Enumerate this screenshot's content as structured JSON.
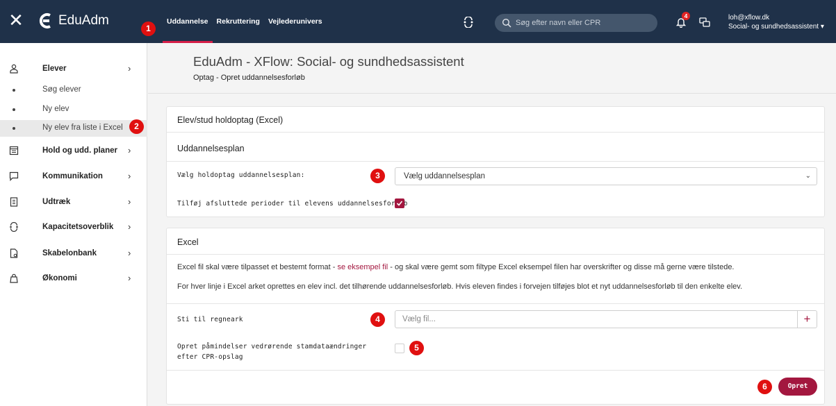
{
  "topbar": {
    "app_name": "EduAdm",
    "nav": [
      "Uddannelse",
      "Rekruttering",
      "Vejlederunivers"
    ],
    "search_placeholder": "Søg efter navn eller CPR",
    "notification_count": "4",
    "user_email": "loh@xflow.dk",
    "user_role": "Social- og sundhedsassistent",
    "user_chevron": "▾"
  },
  "sidebar": {
    "items": [
      {
        "label": "Elever",
        "icon": "person-icon"
      },
      {
        "label": "Hold og udd. planer",
        "icon": "calendar-icon"
      },
      {
        "label": "Kommunikation",
        "icon": "chat-icon"
      },
      {
        "label": "Udtræk",
        "icon": "document-icon"
      },
      {
        "label": "Kapacitetsoverblik",
        "icon": "capacity-icon"
      },
      {
        "label": "Skabelonbank",
        "icon": "template-icon"
      },
      {
        "label": "Økonomi",
        "icon": "bag-icon"
      }
    ],
    "subitems": [
      "Søg elever",
      "Ny elev",
      "Ny elev fra liste i Excel"
    ],
    "chevron": "›"
  },
  "callouts": [
    "1",
    "2",
    "3",
    "4",
    "5",
    "6"
  ],
  "page": {
    "title": "EduAdm - XFlow: Social- og sundhedsassistent",
    "subtitle": "Optag - Opret uddannelsesforløb"
  },
  "card1": {
    "heading": "Elev/stud holdoptag (Excel)",
    "section": "Uddannelsesplan",
    "plan_label": "Vælg holdoptag uddannelsesplan:",
    "plan_value": "Vælg uddannelsesplan",
    "select_chevron": "⌄",
    "periods_label": "Tilføj afsluttede perioder til elevens uddannelsesforløb",
    "periods_checked": true
  },
  "card2": {
    "heading": "Excel",
    "text1_before": "Excel fil skal være tilpasset et bestemt format - ",
    "text1_link": "se eksempel fil",
    "text1_after": " - og skal være gemt som filtype Excel eksempel filen har overskrifter og disse må gerne være tilstede.",
    "text2": "For hver linje i Excel arket oprettes en elev incl. det tilhørende uddannelsesforløb. Hvis eleven findes i forvejen tilføjes blot et nyt uddannelsesforløb til den enkelte elev.",
    "file_label": "Sti til regneark",
    "file_placeholder": "Vælg fil...",
    "file_plus": "+",
    "reminder_label_1": "Opret påmindelser vedrørende stamdataændringer",
    "reminder_label_2": "efter CPR-opslag",
    "reminder_checked": false,
    "submit_label": "Opret"
  },
  "colors": {
    "topbar": "#1f3149",
    "accent": "#a3173f",
    "callout": "#e01010"
  }
}
